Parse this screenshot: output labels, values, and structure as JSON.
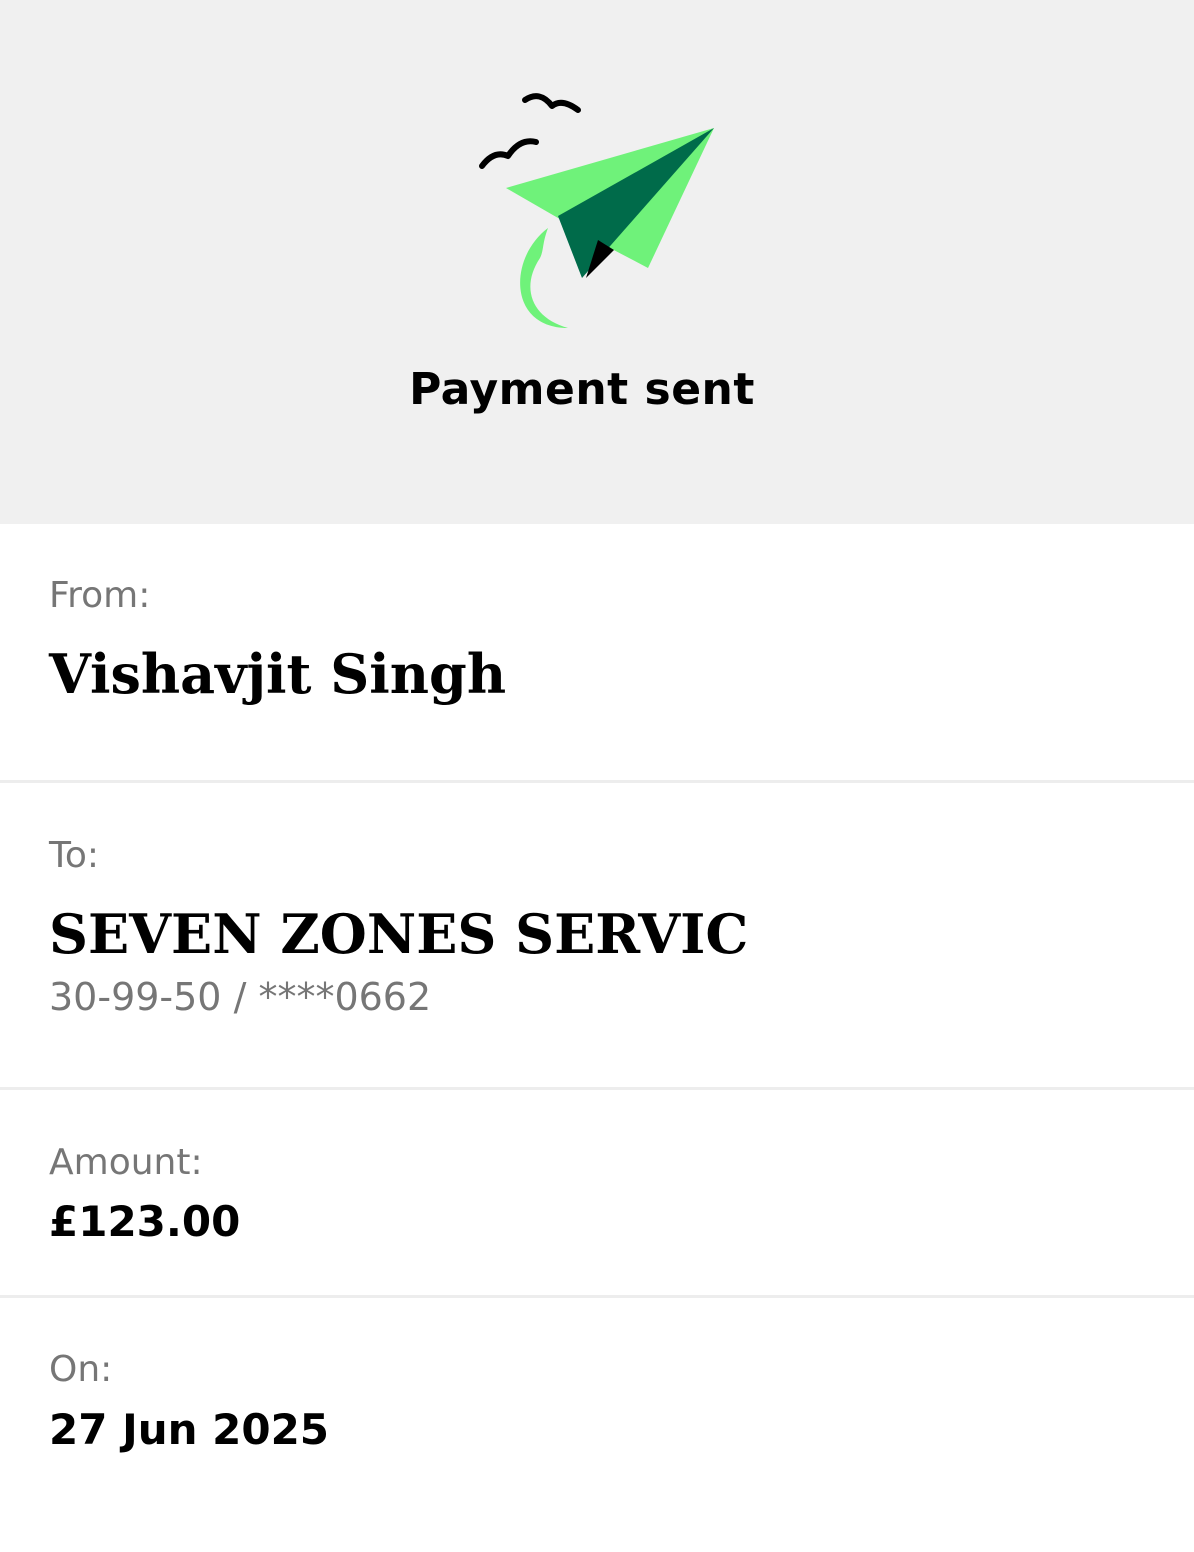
{
  "header": {
    "title": "Payment sent",
    "icon": "paper-plane-icon",
    "background": "#f0f0f0",
    "accent_light": "#6ff27a",
    "accent_dark": "#006b4a"
  },
  "from": {
    "label": "From:",
    "name": "Vishavjit Singh"
  },
  "to": {
    "label": "To:",
    "name": "SEVEN ZONES SERVIC",
    "account": "30-99-50 / ****0662"
  },
  "amount": {
    "label": "Amount:",
    "value": "£123.00"
  },
  "date": {
    "label": "On:",
    "value": "27 Jun 2025"
  }
}
